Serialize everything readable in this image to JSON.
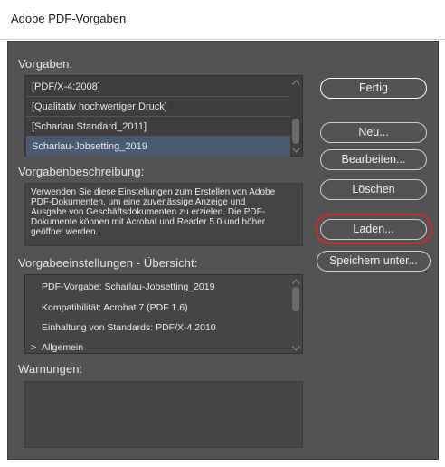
{
  "window": {
    "title": "Adobe PDF-Vorgaben"
  },
  "presets": {
    "label": "Vorgaben:",
    "items": [
      "[PDF/X-4:2008]",
      "[Qualitativ hochwertiger Druck]",
      "[Scharlau Standard_2011]",
      "Scharlau-Jobsetting_2019"
    ],
    "selected_index": 3
  },
  "description": {
    "label": "Vorgabenbeschreibung:",
    "lines": [
      "Verwenden Sie diese Einstellungen zum Erstellen von Adobe",
      "PDF-Dokumenten, um eine zuverlässige Anzeige und",
      "Ausgabe von Geschäftsdokumenten zu erzielen. Die PDF-",
      "Dokumente können mit Acrobat und Reader 5.0 und höher",
      "geöffnet werden."
    ]
  },
  "summary": {
    "label": "Vorgabeeinstellungen - Übersicht:",
    "rows": [
      "PDF-Vorgabe: Scharlau-Jobsetting_2019",
      "Kompatibilität: Acrobat 7 (PDF 1.6)",
      "Einhaltung von Standards: PDF/X-4 2010"
    ],
    "expand_chevron": ">",
    "expand_label": "Allgemein"
  },
  "warnings": {
    "label": "Warnungen:"
  },
  "buttons": {
    "done": "Fertig",
    "new": "Neu...",
    "edit": "Bearbeiten...",
    "delete": "Löschen",
    "load": "Laden...",
    "save_as": "Speichern unter..."
  },
  "colors": {
    "panel_bg": "#535353",
    "selected_row": "#4a5a71",
    "highlight_ring": "#cc2a2a"
  }
}
